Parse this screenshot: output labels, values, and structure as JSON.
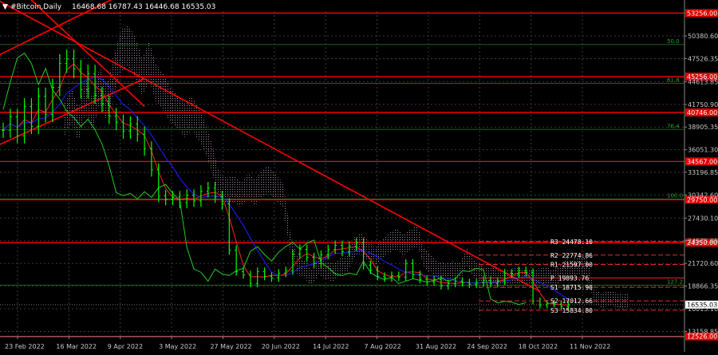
{
  "header": {
    "symbol_label": "#Bitcoin,Daily",
    "ohlc": "16468.68 16787.43 16446.68 16535.03"
  },
  "colors": {
    "background": "#000000",
    "price_bars": "#00ff00",
    "grid": "#3a3a3a",
    "level_lines": "#ff0000",
    "fib_lines": "#1f5f1f",
    "tenkan": "#ff2020",
    "kijun": "#2020ff",
    "chikou": "#22cc22",
    "cloud": "#d8b8d8",
    "pivot_lines": "#ff3030",
    "text": "#ffffff",
    "axis_text": "#c8c8c8"
  },
  "chart_data": {
    "type": "candlestick",
    "title": "#Bitcoin,Daily",
    "y_axis_ticks": [
      "50380.60",
      "47526.35",
      "44613.85",
      "41750.90",
      "38905.35",
      "36051.30",
      "33196.85",
      "30342.60",
      "27430.10",
      "24575.85",
      "21720.60",
      "18866.35",
      "16015.10",
      "13158.85"
    ],
    "x_axis_ticks": [
      "23 Feb 2022",
      "16 Mar 2022",
      "9 Apr 2022",
      "3 May 2022",
      "27 May 2022",
      "20 Jun 2022",
      "14 Jul 2022",
      "7 Aug 2022",
      "31 Aug 2022",
      "24 Sep 2022",
      "18 Oct 2022",
      "11 Nov 2022"
    ],
    "ylim": [
      12500,
      53500
    ],
    "current_price": "16535.03",
    "horizontal_levels": [
      {
        "label": "53256.00",
        "value": 53256
      },
      {
        "label": "45256.00",
        "value": 45256
      },
      {
        "label": "40746.00",
        "value": 40746
      },
      {
        "label": "34567.00",
        "value": 34567
      },
      {
        "label": "29750.00",
        "value": 29750
      },
      {
        "label": "24350.00",
        "value": 24350
      },
      {
        "label": "12526.00",
        "value": 12526
      }
    ],
    "fib_levels": [
      {
        "label": "50.0",
        "value": 49300
      },
      {
        "label": "61.8",
        "value": 44400
      },
      {
        "label": "76.4",
        "value": 38600
      },
      {
        "label": "100.0",
        "value": 29850
      },
      {
        "label": "127.2",
        "value": 19000
      }
    ],
    "pivots": [
      {
        "label": "R3 24478.10",
        "value": 24478.1
      },
      {
        "label": "R2 22774.86",
        "value": 22774.86
      },
      {
        "label": "R1 21597.00",
        "value": 21597.0
      },
      {
        "label": "P 19893.76",
        "value": 19893.76
      },
      {
        "label": "S1 18715.90",
        "value": 18715.9
      },
      {
        "label": "S2 17012.66",
        "value": 17012.66
      },
      {
        "label": "S3 15834.80",
        "value": 15834.8
      }
    ],
    "price_series": [
      {
        "d": 0,
        "c": 38500
      },
      {
        "d": 3,
        "c": 40200
      },
      {
        "d": 6,
        "c": 37800
      },
      {
        "d": 9,
        "c": 41500
      },
      {
        "d": 12,
        "c": 39000
      },
      {
        "d": 15,
        "c": 42800
      },
      {
        "d": 18,
        "c": 40500
      },
      {
        "d": 21,
        "c": 43900
      },
      {
        "d": 24,
        "c": 46900
      },
      {
        "d": 27,
        "c": 47500
      },
      {
        "d": 30,
        "c": 46200
      },
      {
        "d": 33,
        "c": 43600
      },
      {
        "d": 36,
        "c": 45600
      },
      {
        "d": 39,
        "c": 42900
      },
      {
        "d": 42,
        "c": 41800
      },
      {
        "d": 45,
        "c": 40300
      },
      {
        "d": 48,
        "c": 39500
      },
      {
        "d": 51,
        "c": 38400
      },
      {
        "d": 54,
        "c": 39300
      },
      {
        "d": 57,
        "c": 38000
      },
      {
        "d": 60,
        "c": 36200
      },
      {
        "d": 63,
        "c": 33500
      },
      {
        "d": 66,
        "c": 30200
      },
      {
        "d": 69,
        "c": 29800
      },
      {
        "d": 72,
        "c": 30100
      },
      {
        "d": 75,
        "c": 29400
      },
      {
        "d": 78,
        "c": 30300
      },
      {
        "d": 81,
        "c": 29600
      },
      {
        "d": 84,
        "c": 30800
      },
      {
        "d": 87,
        "c": 31200
      },
      {
        "d": 90,
        "c": 30100
      },
      {
        "d": 93,
        "c": 29200
      },
      {
        "d": 96,
        "c": 23400
      },
      {
        "d": 99,
        "c": 20700
      },
      {
        "d": 102,
        "c": 20300
      },
      {
        "d": 105,
        "c": 19200
      },
      {
        "d": 108,
        "c": 20700
      },
      {
        "d": 111,
        "c": 20100
      },
      {
        "d": 114,
        "c": 19900
      },
      {
        "d": 117,
        "c": 20500
      },
      {
        "d": 120,
        "c": 20800
      },
      {
        "d": 123,
        "c": 22900
      },
      {
        "d": 126,
        "c": 23500
      },
      {
        "d": 129,
        "c": 22500
      },
      {
        "d": 132,
        "c": 21700
      },
      {
        "d": 135,
        "c": 22800
      },
      {
        "d": 138,
        "c": 23500
      },
      {
        "d": 141,
        "c": 24000
      },
      {
        "d": 144,
        "c": 23200
      },
      {
        "d": 147,
        "c": 23900
      },
      {
        "d": 150,
        "c": 24300
      },
      {
        "d": 153,
        "c": 21500
      },
      {
        "d": 156,
        "c": 20900
      },
      {
        "d": 159,
        "c": 20100
      },
      {
        "d": 162,
        "c": 19900
      },
      {
        "d": 165,
        "c": 20200
      },
      {
        "d": 168,
        "c": 20000
      },
      {
        "d": 171,
        "c": 21700
      },
      {
        "d": 174,
        "c": 20300
      },
      {
        "d": 177,
        "c": 19700
      },
      {
        "d": 180,
        "c": 19400
      },
      {
        "d": 183,
        "c": 19700
      },
      {
        "d": 186,
        "c": 18900
      },
      {
        "d": 189,
        "c": 19200
      },
      {
        "d": 192,
        "c": 19500
      },
      {
        "d": 195,
        "c": 19300
      },
      {
        "d": 198,
        "c": 19100
      },
      {
        "d": 201,
        "c": 19300
      },
      {
        "d": 204,
        "c": 19600
      },
      {
        "d": 207,
        "c": 19200
      },
      {
        "d": 210,
        "c": 19500
      },
      {
        "d": 213,
        "c": 20500
      },
      {
        "d": 216,
        "c": 20400
      },
      {
        "d": 219,
        "c": 20800
      },
      {
        "d": 222,
        "c": 20600
      },
      {
        "d": 225,
        "c": 17000
      },
      {
        "d": 228,
        "c": 16500
      },
      {
        "d": 231,
        "c": 16700
      },
      {
        "d": 234,
        "c": 16600
      },
      {
        "d": 237,
        "c": 16300
      },
      {
        "d": 240,
        "c": 16535
      }
    ]
  }
}
